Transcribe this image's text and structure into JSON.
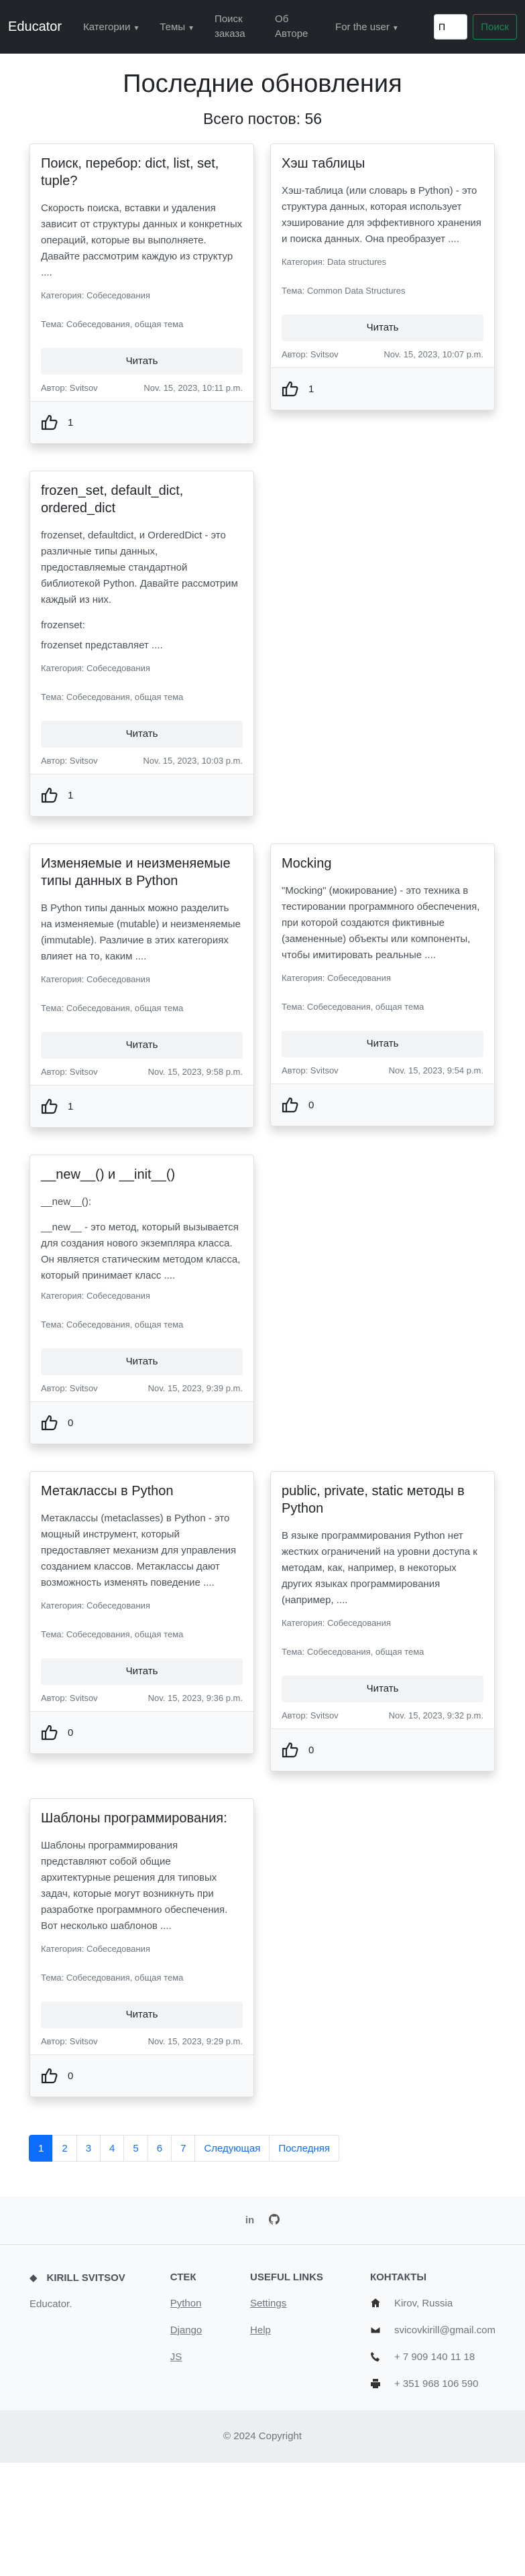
{
  "nav": {
    "brand": "Educator",
    "categories": "Категории",
    "topics": "Темы",
    "search_nav": "Поиск заказа",
    "about": "Об Авторе",
    "for_user": "For the user",
    "search_value": "П",
    "search_button": "Поиск"
  },
  "main": {
    "title": "Последние обновления",
    "count": "Всего постов: 56"
  },
  "posts": [
    {
      "title": "Поиск, перебор: dict, list, set, tuple?",
      "excerpt": "Скорость поиска, вставки и удаления зависит от структуры данных и конкретных операций, которые вы выполняете. Давайте рассмотрим каждую из структур ....",
      "category": "Категория: Собеседования",
      "topic": "Тема: Собеседования, общая тема",
      "read": "Читать",
      "author": "Автор: Svitsov",
      "date": "Nov. 15, 2023, 10:11 p.m.",
      "likes": "1"
    },
    {
      "title": "Хэш таблицы",
      "excerpt": "Хэш-таблица (или словарь в Python) - это структура данных, которая использует хэширование для эффективного хранения и поиска данных. Она преобразует ....",
      "category": "Категория: Data structures",
      "topic": "Тема: Common Data Structures",
      "read": "Читать",
      "author": "Автор: Svitsov",
      "date": "Nov. 15, 2023, 10:07 p.m.",
      "likes": "1"
    },
    {
      "title": "frozen_set, default_dict, ordered_dict",
      "excerpt": "frozenset, defaultdict, и OrderedDict - это различные типы данных, предоставляемые стандартной библиотекой Python. Давайте рассмотрим каждый из них.",
      "excerpt2": "frozenset:",
      "excerpt3": "frozenset представляет ....",
      "category": "Категория: Собеседования",
      "topic": "Тема: Собеседования, общая тема",
      "read": "Читать",
      "author": "Автор: Svitsov",
      "date": "Nov. 15, 2023, 10:03 p.m.",
      "likes": "1"
    },
    {
      "title": "Изменяемые и неизменяемые типы данных в Python",
      "excerpt": "В Python типы данных можно разделить на изменяемые (mutable) и неизменяемые (immutable). Различие в этих категориях влияет на то, каким ....",
      "category": "Категория: Собеседования",
      "topic": "Тема: Собеседования, общая тема",
      "read": "Читать",
      "author": "Автор: Svitsov",
      "date": "Nov. 15, 2023, 9:58 p.m.",
      "likes": "1"
    },
    {
      "title": "Mocking",
      "excerpt": "\"Mocking\" (мокирование) - это техника в тестировании программного обеспечения, при которой создаются фиктивные (замененные) объекты или компоненты, чтобы имитировать реальные ....",
      "category": "Категория: Собеседования",
      "topic": "Тема: Собеседования, общая тема",
      "read": "Читать",
      "author": "Автор: Svitsov",
      "date": "Nov. 15, 2023, 9:54 p.m.",
      "likes": "0"
    },
    {
      "title": "__new__() и __init__()",
      "excerpt": "__new__():",
      "excerpt2": "__new__ - это метод, который вызывается для создания нового экземпляра класса. Он является статическим методом класса, который принимает класс ....",
      "category": "Категория: Собеседования",
      "topic": "Тема: Собеседования, общая тема",
      "read": "Читать",
      "author": "Автор: Svitsov",
      "date": "Nov. 15, 2023, 9:39 p.m.",
      "likes": "0"
    },
    {
      "title": "Метаклассы в Python",
      "excerpt": "Метаклассы (metaclasses) в Python - это мощный инструмент, который предоставляет механизм для управления созданием классов. Метаклассы дают возможность изменять поведение ....",
      "category": "Категория: Собеседования",
      "topic": "Тема: Собеседования, общая тема",
      "read": "Читать",
      "author": "Автор: Svitsov",
      "date": "Nov. 15, 2023, 9:36 p.m.",
      "likes": "0"
    },
    {
      "title": "public, private, static методы в Python",
      "excerpt": "В языке программирования Python нет жестких ограничений на уровни доступа к методам, как, например, в некоторых других языках программирования (например, ....",
      "category": "Категория: Собеседования",
      "topic": "Тема: Собеседования, общая тема",
      "read": "Читать",
      "author": "Автор: Svitsov",
      "date": "Nov. 15, 2023, 9:32 p.m.",
      "likes": "0"
    },
    {
      "title": "Шаблоны программирования:",
      "excerpt": "Шаблоны программирования представляют собой общие архитектурные решения для типовых задач, которые могут возникнуть при разработке программного обеспечения. Вот несколько шаблонов ....",
      "category": "Категория: Собеседования",
      "topic": "Тема: Собеседования, общая тема",
      "read": "Читать",
      "author": "Автор: Svitsov",
      "date": "Nov. 15, 2023, 9:29 p.m.",
      "likes": "0"
    }
  ],
  "pagination": {
    "pages": [
      "1",
      "2",
      "3",
      "4",
      "5",
      "6",
      "7"
    ],
    "next": "Следующая",
    "last": "Последняя"
  },
  "footer": {
    "social": [
      "in",
      "github-icon"
    ],
    "brand": "KIRILL SVITSOV",
    "brand_sub": "Educator.",
    "stack_title": "СТЕК",
    "stack": [
      "Python",
      "Django",
      "JS"
    ],
    "useful_title": "USEFUL LINKS",
    "useful": [
      "Settings",
      "Help"
    ],
    "contacts_title": "КОНТАКТЫ",
    "contacts": [
      "Kirov, Russia",
      "svicovkirill@gmail.com",
      "+ 7 909 140 11 18",
      "+ 351 968 106 590"
    ],
    "copyright": "© 2024 Copyright"
  },
  "colors": {
    "navbar": "#212529",
    "primary": "#0d6efd",
    "success": "#198754"
  }
}
